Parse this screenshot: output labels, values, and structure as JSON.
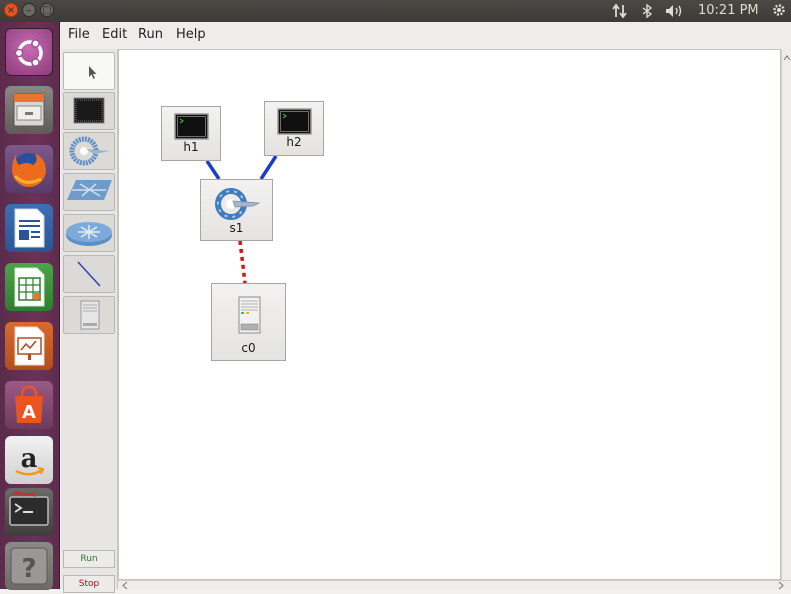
{
  "titlebar": {
    "close_glyph": "×",
    "minimize_glyph": "–",
    "maximize_glyph": "□"
  },
  "indicators": {
    "network_icon": "network-arrows-icon",
    "bluetooth_icon": "bluetooth-icon",
    "volume_icon": "volume-icon",
    "settings_icon": "gear-icon"
  },
  "clock": {
    "time": "10:21 PM"
  },
  "launcher": {
    "items": [
      "ubuntu-dash",
      "files",
      "firefox",
      "libreoffice-writer",
      "libreoffice-calc",
      "libreoffice-impress",
      "software-center",
      "amazon",
      "terminal",
      "help"
    ]
  },
  "menubar": {
    "file": "File",
    "edit": "Edit",
    "run": "Run",
    "help": "Help"
  },
  "palette": {
    "tools": [
      "select",
      "host",
      "switch",
      "legacy-switch",
      "router",
      "link",
      "controller"
    ],
    "run_label": "Run",
    "stop_label": "Stop"
  },
  "topology": {
    "nodes": [
      {
        "id": "h1",
        "label": "h1",
        "type": "host"
      },
      {
        "id": "h2",
        "label": "h2",
        "type": "host"
      },
      {
        "id": "s1",
        "label": "s1",
        "type": "switch"
      },
      {
        "id": "c0",
        "label": "c0",
        "type": "controller"
      }
    ],
    "links": [
      {
        "from": "h1",
        "to": "s1",
        "style": "solid",
        "color": "#1a3ec8"
      },
      {
        "from": "h2",
        "to": "s1",
        "style": "solid",
        "color": "#1a3ec8"
      },
      {
        "from": "s1",
        "to": "c0",
        "style": "dashed",
        "color": "#e01010"
      }
    ]
  },
  "colors": {
    "accent": "#e95420",
    "launcher": "#6a3257",
    "run_text": "#2a7d2a",
    "stop_text": "#a01515"
  }
}
